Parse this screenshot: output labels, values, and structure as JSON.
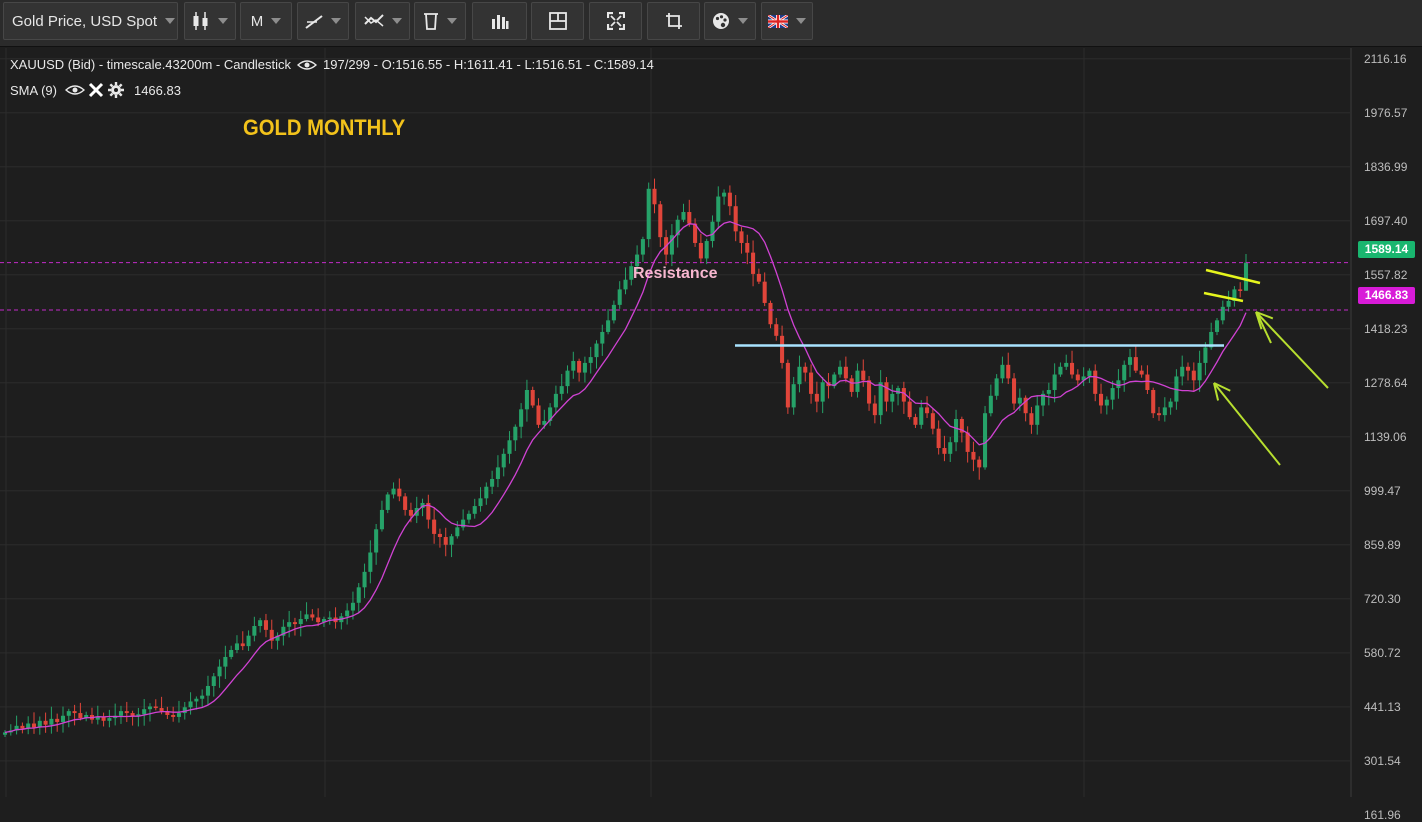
{
  "toolbar": {
    "symbol_label": "Gold Price, USD Spot",
    "timeframe_label": "M",
    "icons": [
      "candlestick-icon",
      "line-draw-icon",
      "compare-icon",
      "delete-icon",
      "indicator-icon",
      "layout-icon",
      "fullscreen-icon",
      "crop-icon",
      "palette-icon",
      "language-flag-icon"
    ]
  },
  "legend": {
    "series_info": "XAUUSD (Bid) - timescale.43200m - Candlestick",
    "ohlc": "197/299 - O:1516.55 - H:1611.41 - L:1516.51 - C:1589.14",
    "sma_label": "SMA (9)",
    "sma_value": "1466.83"
  },
  "annotations": {
    "title": "GOLD MONTHLY",
    "resistance": "Resistance"
  },
  "price_tags": {
    "last_price": "1589.14",
    "sma_price": "1466.83"
  },
  "colors": {
    "background": "#1e1e1e",
    "bull": "#26a269",
    "bear": "#e0453a",
    "sma": "#d042d3",
    "resistance_line": "#a9e3ff",
    "highlight": "#e6f51d",
    "title": "#f2c21b",
    "last_price_tag": "#19b66f",
    "sma_tag": "#d81bd8"
  },
  "chart_data": {
    "type": "candlestick",
    "symbol": "XAUUSD",
    "timeframe": "monthly",
    "ylim": [
      95,
      2180
    ],
    "y_ticks": [
      "2116.16",
      "1976.57",
      "1836.99",
      "1697.40",
      "1557.82",
      "1418.23",
      "1278.64",
      "1139.06",
      "999.47",
      "859.89",
      "720.30",
      "580.72",
      "441.13",
      "301.54",
      "161.96"
    ],
    "last_candle": {
      "open": 1516.55,
      "high": 1611.41,
      "low": 1516.51,
      "close": 1589.14
    },
    "sma_period": 9,
    "sma_last": 1466.83,
    "horizontal_levels": [
      1589.14,
      1466.83
    ],
    "resistance_level": 1375,
    "close_series": [
      375,
      380,
      392,
      385,
      398,
      388,
      405,
      395,
      410,
      402,
      418,
      430,
      425,
      412,
      420,
      408,
      415,
      405,
      412,
      418,
      430,
      425,
      418,
      422,
      435,
      442,
      438,
      430,
      420,
      415,
      425,
      440,
      455,
      462,
      470,
      495,
      520,
      545,
      570,
      588,
      605,
      598,
      625,
      650,
      665,
      640,
      612,
      625,
      648,
      660,
      655,
      668,
      680,
      672,
      660,
      668,
      672,
      660,
      675,
      690,
      710,
      750,
      790,
      840,
      900,
      950,
      990,
      1005,
      985,
      950,
      935,
      955,
      968,
      925,
      888,
      880,
      860,
      882,
      905,
      925,
      940,
      960,
      980,
      1010,
      1030,
      1060,
      1095,
      1130,
      1165,
      1210,
      1260,
      1220,
      1170,
      1180,
      1215,
      1250,
      1270,
      1310,
      1335,
      1305,
      1330,
      1345,
      1380,
      1410,
      1440,
      1480,
      1520,
      1545,
      1580,
      1610,
      1650,
      1780,
      1740,
      1655,
      1610,
      1660,
      1700,
      1720,
      1690,
      1640,
      1600,
      1645,
      1695,
      1760,
      1770,
      1735,
      1670,
      1640,
      1615,
      1560,
      1540,
      1485,
      1430,
      1400,
      1330,
      1215,
      1275,
      1320,
      1305,
      1250,
      1230,
      1280,
      1270,
      1300,
      1320,
      1290,
      1255,
      1310,
      1285,
      1225,
      1195,
      1280,
      1230,
      1250,
      1265,
      1230,
      1190,
      1170,
      1215,
      1200,
      1160,
      1110,
      1095,
      1125,
      1185,
      1150,
      1100,
      1080,
      1060,
      1200,
      1245,
      1290,
      1325,
      1290,
      1225,
      1240,
      1200,
      1170,
      1220,
      1250,
      1260,
      1300,
      1320,
      1330,
      1300,
      1285,
      1295,
      1310,
      1250,
      1220,
      1235,
      1265,
      1285,
      1325,
      1345,
      1310,
      1300,
      1260,
      1200,
      1195,
      1215,
      1230,
      1295,
      1320,
      1310,
      1285,
      1330,
      1370,
      1410,
      1440,
      1475,
      1490,
      1520,
      1516,
      1589
    ]
  }
}
